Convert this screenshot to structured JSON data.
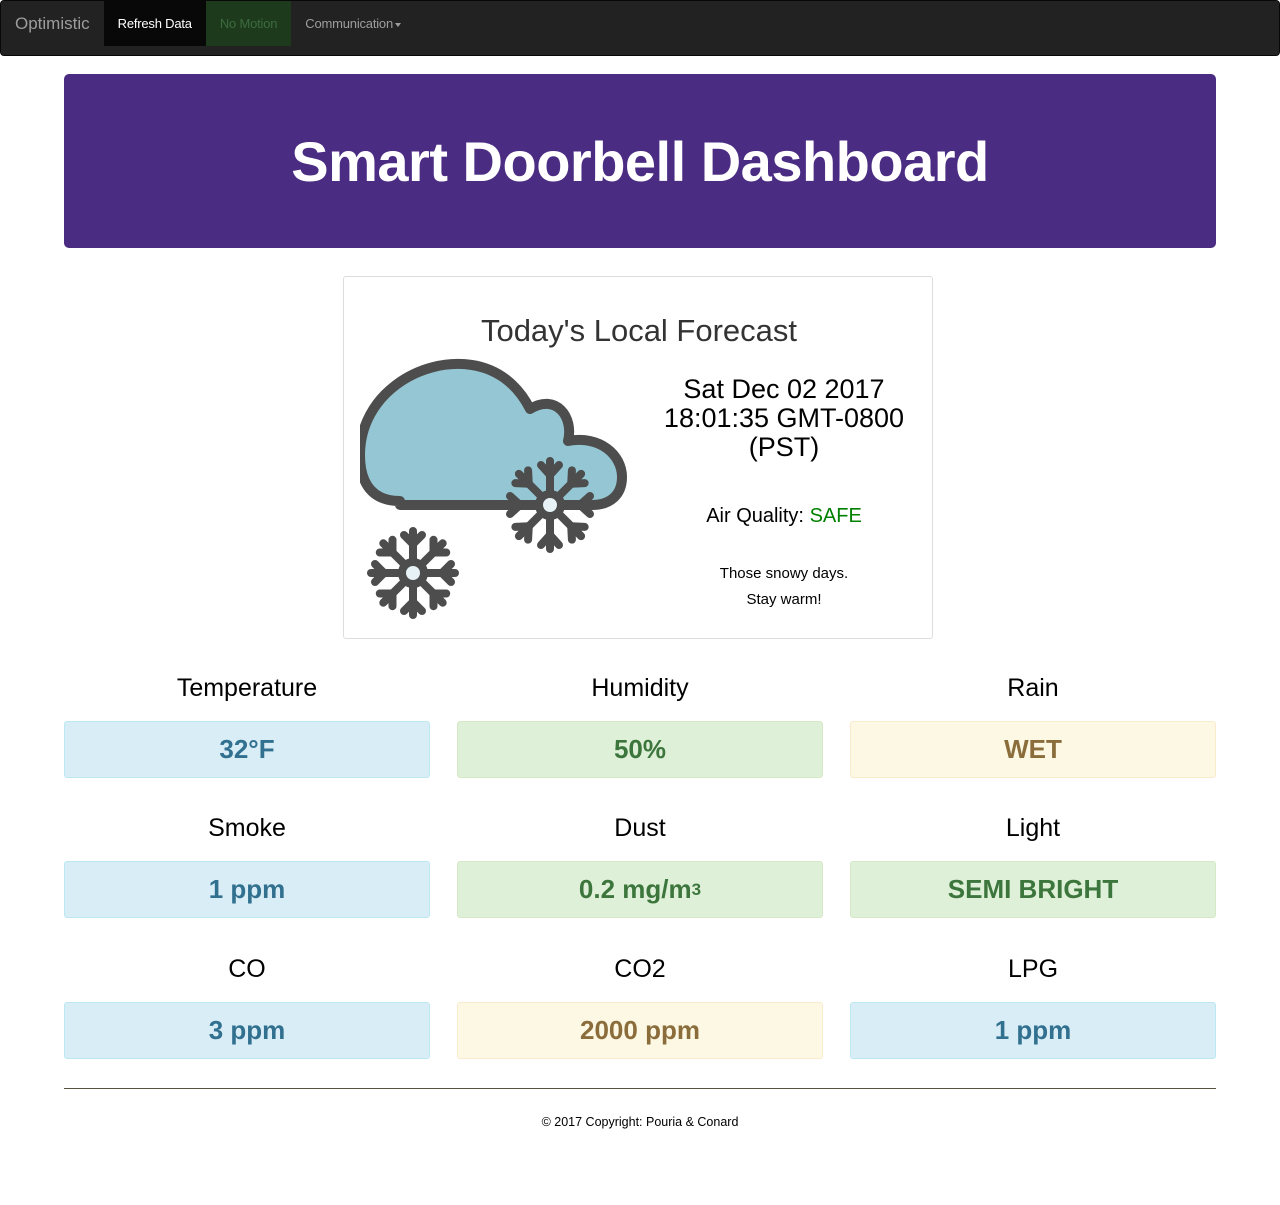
{
  "navbar": {
    "brand": "Optimistic",
    "refresh_label": "Refresh Data",
    "motion_label": "No Motion",
    "communication_label": "Communication"
  },
  "header": {
    "title": "Smart Doorbell Dashboard"
  },
  "forecast": {
    "title": "Today's Local Forecast",
    "icon": "snow-cloud-icon",
    "date_line1": "Sat Dec 02 2017",
    "date_line2": "18:01:35 GMT-0800",
    "date_line3": "(PST)",
    "air_quality_label": "Air Quality:",
    "air_quality_value": "SAFE",
    "message_line1": "Those snowy days.",
    "message_line2": "Stay warm!"
  },
  "sensors": {
    "temperature": {
      "label": "Temperature",
      "value": "32°F"
    },
    "humidity": {
      "label": "Humidity",
      "value": "50%"
    },
    "rain": {
      "label": "Rain",
      "value": "WET"
    },
    "smoke": {
      "label": "Smoke",
      "value": "1 ppm"
    },
    "dust": {
      "label": "Dust",
      "value": "0.2 mg/m",
      "unit_sup": "3"
    },
    "light": {
      "label": "Light",
      "value": "SEMI BRIGHT"
    },
    "co": {
      "label": "CO",
      "value": "3 ppm"
    },
    "co2": {
      "label": "CO2",
      "value": "2000 ppm"
    },
    "lpg": {
      "label": "LPG",
      "value": "1 ppm"
    }
  },
  "footer": {
    "copyright": "© 2017 Copyright: Pouria & Conard"
  },
  "colors": {
    "navbar_bg": "#222222",
    "header_bg": "#4b2c83",
    "info": "#31708f",
    "success": "#3c763d",
    "warning": "#8a6d3b",
    "safe": "#008000"
  }
}
